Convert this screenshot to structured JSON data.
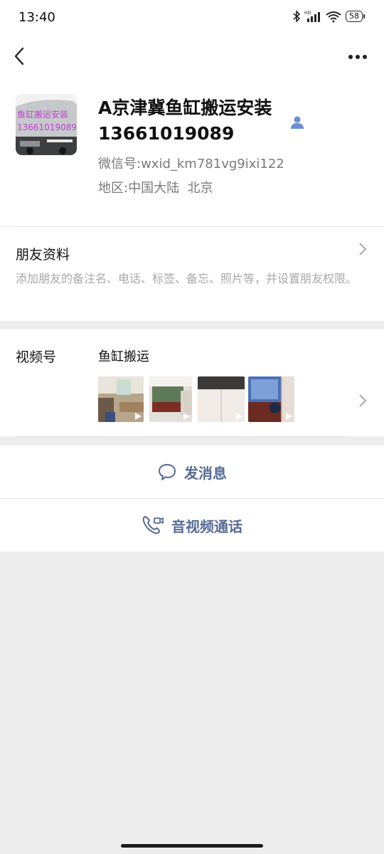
{
  "status_bar": {
    "time": "13:40",
    "battery": "58"
  },
  "profile": {
    "avatar_text_line1": "鱼缸搬运安装",
    "avatar_text_line2": "13661019089",
    "nickname": "A京津冀鱼缸搬运安装13661019089",
    "wechat_id_label": "微信号:",
    "wechat_id": "wxid_km781vg9ixi122",
    "region_label": "地区:",
    "region": "中国大陆  北京"
  },
  "friend_info": {
    "title": "朋友资料",
    "description": "添加朋友的备注名、电话、标签、备忘、照片等，并设置朋友权限。"
  },
  "channels": {
    "label": "视频号",
    "name": "鱼缸搬运"
  },
  "actions": {
    "send_message": "发消息",
    "av_call": "音视频通话"
  },
  "colors": {
    "link": "#576b95",
    "background": "#ededed"
  }
}
